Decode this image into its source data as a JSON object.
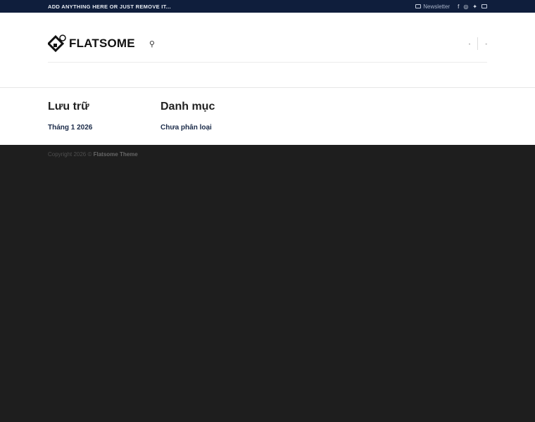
{
  "topbar": {
    "message": "ADD ANYTHING HERE OR JUST REMOVE IT...",
    "newsletter": "Newsletter"
  },
  "header": {
    "logo": "FLATSOME",
    "menu": [
      "-",
      "-"
    ]
  },
  "widgets": [
    {
      "title": "Lưu trữ",
      "link": "Tháng 1 2026"
    },
    {
      "title": "Danh mục",
      "link": "Chưa phân loại"
    }
  ],
  "footer": {
    "copyright": "Copyright 2026 ©",
    "theme": "Flatsome Theme"
  }
}
